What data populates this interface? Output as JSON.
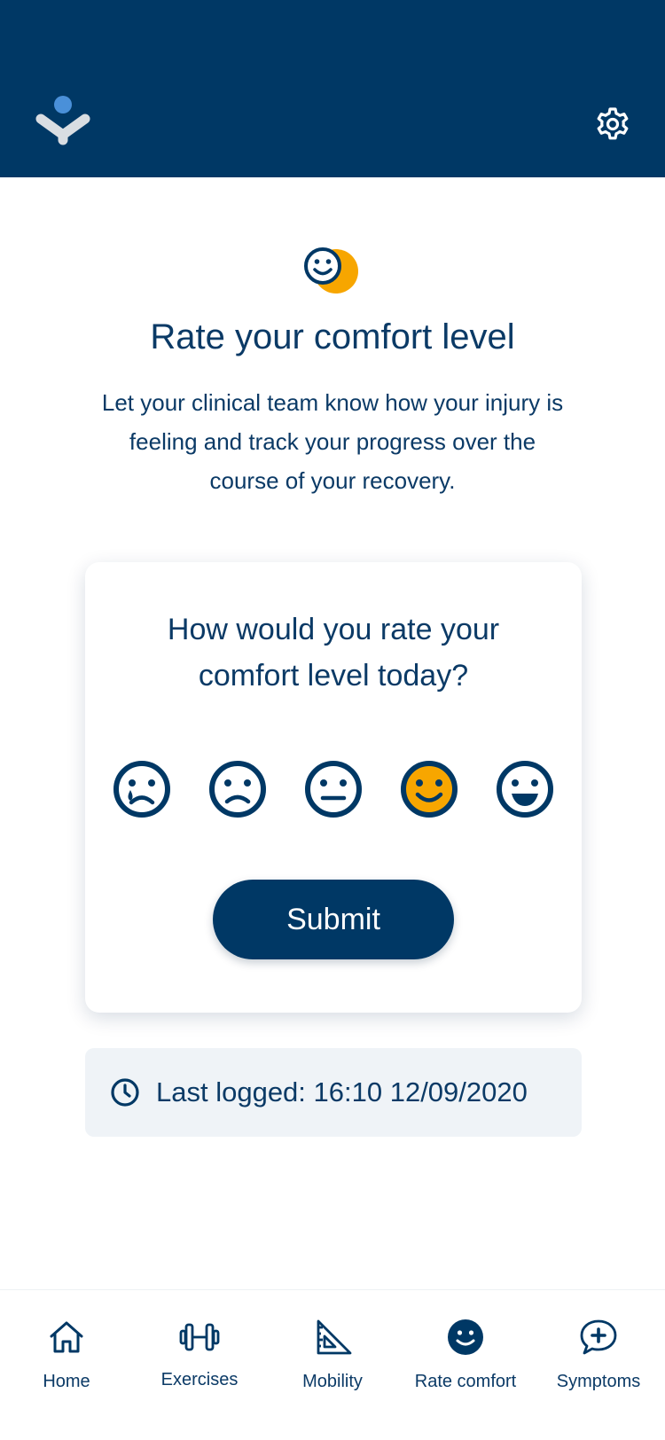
{
  "header": {
    "logo_icon": "brand-logo",
    "settings_icon": "gear-icon"
  },
  "main": {
    "hero_icon": "comfort-face-icon",
    "title": "Rate your comfort level",
    "description": "Let your clinical team know how your injury is feeling and track your progress over the course of your recovery."
  },
  "card": {
    "question": "How would you rate your comfort level today?",
    "faces": [
      {
        "icon": "crying-face-icon",
        "selected": false
      },
      {
        "icon": "sad-face-icon",
        "selected": false
      },
      {
        "icon": "neutral-face-icon",
        "selected": false
      },
      {
        "icon": "smiling-face-icon",
        "selected": true
      },
      {
        "icon": "grinning-face-icon",
        "selected": false
      }
    ],
    "submit_label": "Submit"
  },
  "last_logged": {
    "icon": "clock-icon",
    "text": "Last logged: 16:10 12/09/2020"
  },
  "nav": {
    "items": [
      {
        "label": "Home",
        "icon": "home-icon"
      },
      {
        "label": "Exercises",
        "icon": "dumbbell-icon"
      },
      {
        "label": "Mobility",
        "icon": "set-square-icon"
      },
      {
        "label": "Rate comfort",
        "icon": "smiley-icon",
        "active": true
      },
      {
        "label": "Symptoms",
        "icon": "chat-plus-icon"
      }
    ]
  },
  "colors": {
    "primary": "#003865",
    "accent": "#f7a600",
    "logo_dot": "#4a90d9",
    "panel": "#eff3f7"
  }
}
